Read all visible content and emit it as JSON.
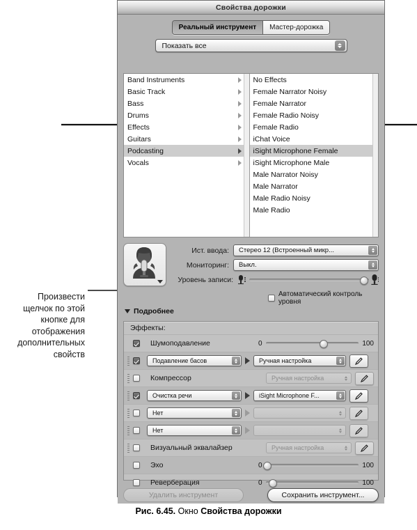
{
  "window": {
    "title": "Свойства дорожки",
    "segmented": {
      "options": [
        "Реальный инструмент",
        "Мастер-дорожка"
      ],
      "selected": "Реальный инструмент"
    },
    "filter_popup": {
      "value": "Показать все"
    }
  },
  "category_list": {
    "items": [
      {
        "label": "Band Instruments",
        "selected": false
      },
      {
        "label": "Basic Track",
        "selected": false
      },
      {
        "label": "Bass",
        "selected": false
      },
      {
        "label": "Drums",
        "selected": false
      },
      {
        "label": "Effects",
        "selected": false
      },
      {
        "label": "Guitars",
        "selected": false
      },
      {
        "label": "Podcasting",
        "selected": true
      },
      {
        "label": "Vocals",
        "selected": false
      }
    ]
  },
  "preset_list": {
    "items": [
      {
        "label": "No Effects",
        "selected": false
      },
      {
        "label": "Female Narrator Noisy",
        "selected": false
      },
      {
        "label": "Female Narrator",
        "selected": false
      },
      {
        "label": "Female Radio Noisy",
        "selected": false
      },
      {
        "label": "Female Radio",
        "selected": false
      },
      {
        "label": "iChat Voice",
        "selected": false
      },
      {
        "label": "iSight Microphone Female",
        "selected": true
      },
      {
        "label": "iSight Microphone Male",
        "selected": false
      },
      {
        "label": "Male Narrator Noisy",
        "selected": false
      },
      {
        "label": "Male Narrator",
        "selected": false
      },
      {
        "label": "Male Radio Noisy",
        "selected": false
      },
      {
        "label": "Male Radio",
        "selected": false
      }
    ]
  },
  "input": {
    "source_label": "Ист. ввода:",
    "source_value": "Стерео 12 (Встроенный микр...",
    "monitor_label": "Мониторинг:",
    "monitor_value": "Выкл.",
    "level_label": "Уровень записи:",
    "level_value": 96,
    "auto_label": "Автоматический контроль уровня",
    "auto_checked": false
  },
  "details": {
    "label": "Подробнее",
    "expanded": true
  },
  "effects": {
    "header": "Эффекты:",
    "rows": [
      {
        "kind": "slider",
        "checked": true,
        "name": "Шумоподавление",
        "min": "0",
        "max": "100",
        "value": 62
      },
      {
        "kind": "effect",
        "checked": true,
        "name": "Подавление басов",
        "preset": "Ручная настройка",
        "enabled": true
      },
      {
        "kind": "plain",
        "checked": false,
        "name": "Компрессор",
        "preset": "Ручная настройка",
        "enabled": false
      },
      {
        "kind": "effect",
        "checked": true,
        "name": "Очистка речи",
        "preset": "iSight Microphone F...",
        "enabled": true
      },
      {
        "kind": "effect",
        "checked": false,
        "name": "Нет",
        "preset": "",
        "enabled": false
      },
      {
        "kind": "effect",
        "checked": false,
        "name": "Нет",
        "preset": "",
        "enabled": false
      },
      {
        "kind": "plain",
        "checked": false,
        "name": "Визуальный эквалайзер",
        "preset": "Ручная настройка",
        "enabled": false
      },
      {
        "kind": "slider",
        "checked": false,
        "name": "Эхо",
        "min": "0",
        "max": "100",
        "value": 1
      },
      {
        "kind": "slider",
        "checked": false,
        "name": "Реверберация",
        "min": "0",
        "max": "100",
        "value": 7
      }
    ]
  },
  "footer": {
    "delete_label": "Удалить инструмент",
    "save_label": "Сохранить инструмент..."
  },
  "annotations": {
    "left_note": "Произвести\nщелчок по этой\nкнопке для\nотображения\nдополнительных\nсвойств"
  },
  "caption": {
    "figure": "Рис. 6.45.",
    "text": "Окно",
    "bold": "Свойства дорожки"
  }
}
